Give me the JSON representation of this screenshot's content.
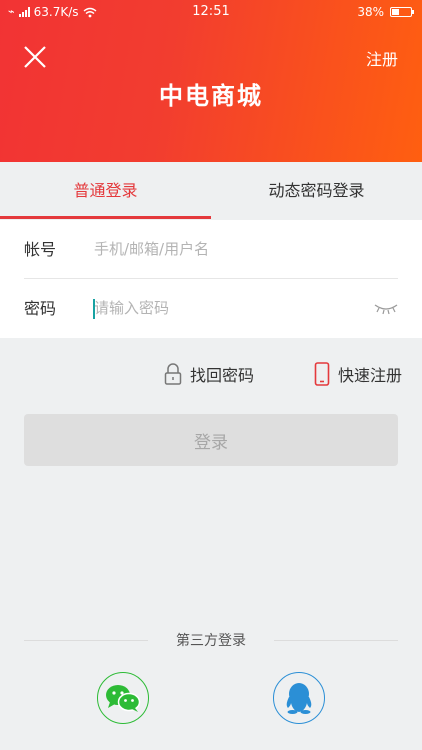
{
  "status_bar": {
    "carrier": "🐾",
    "network_speed": "63.7K/s",
    "time": "12:51",
    "battery": "38%",
    "battery_level": 0.38
  },
  "header": {
    "title": "中电商城",
    "register_label": "注册",
    "close_icon": "close-icon"
  },
  "tabs": [
    {
      "label": "普通登录",
      "active": true
    },
    {
      "label": "动态密码登录",
      "active": false
    }
  ],
  "form": {
    "account": {
      "label": "帐号",
      "placeholder": "手机/邮箱/用户名",
      "value": ""
    },
    "password": {
      "label": "密码",
      "placeholder": "请输入密码",
      "value": ""
    }
  },
  "links": {
    "forgot_password": "找回密码",
    "quick_register": "快速注册"
  },
  "login_button": "登录",
  "third_party": {
    "label": "第三方登录",
    "providers": [
      "wechat",
      "qq"
    ]
  },
  "colors": {
    "accent": "#e4393c",
    "gradient_start": "#f23334",
    "gradient_end": "#ff5f10",
    "wechat": "#2dbb36",
    "qq": "#2b8fd6"
  }
}
